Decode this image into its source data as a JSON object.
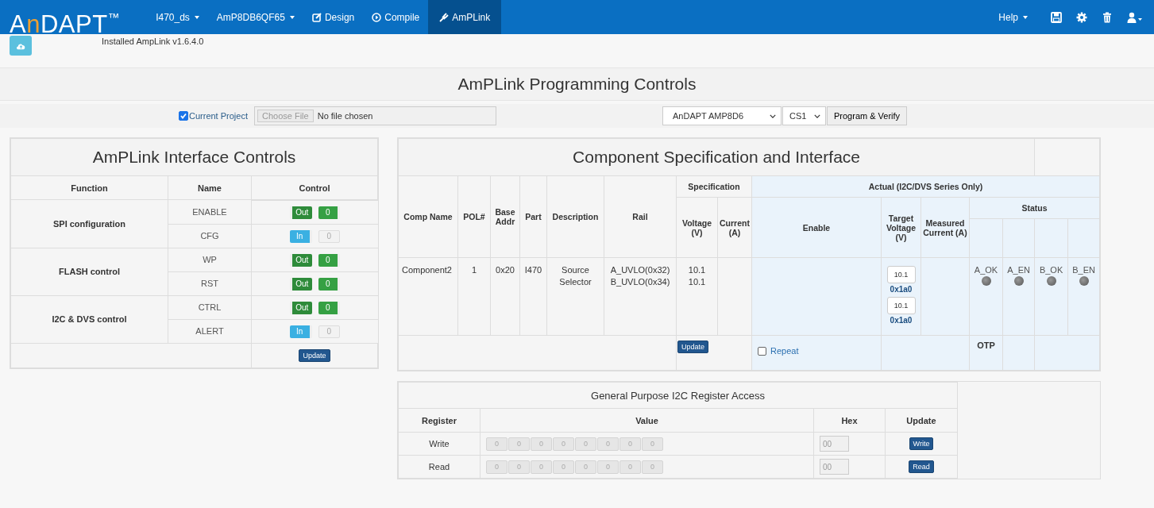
{
  "navbar": {
    "logo": {
      "start": "A",
      "accent": "n",
      "end": "DAPT",
      "mark": "™"
    },
    "items": [
      {
        "label": "I470_ds",
        "kind": "dropdown",
        "selected": false
      },
      {
        "label": "AmP8DB6QF65",
        "kind": "dropdown",
        "selected": false
      },
      {
        "label": "Design",
        "kind": "link",
        "selected": false
      },
      {
        "label": "Compile",
        "kind": "link",
        "selected": false
      },
      {
        "label": "AmPLink",
        "kind": "link",
        "selected": true
      }
    ],
    "help": "Help"
  },
  "install_note": "Installed AmpLink v1.6.4.0",
  "page_title": "AmPLink Programming Controls",
  "program_bar": {
    "current_project": {
      "label": "Current Project",
      "checked": true
    },
    "file_button": "Choose File",
    "file_status": "No file chosen",
    "device": "AnDAPT AMP8D6",
    "chip_select": "CS1",
    "program_button": "Program & Verify"
  },
  "interface_panel": {
    "title": "AmPLink Interface Controls",
    "columns": [
      "Function",
      "Name",
      "Control"
    ],
    "groups": [
      {
        "function": "SPI configuration",
        "signals": [
          {
            "name": "ENABLE",
            "direction": "Out",
            "output": true,
            "value": "0"
          },
          {
            "name": "CFG",
            "direction": "In",
            "output": false,
            "value": "0"
          }
        ]
      },
      {
        "function": "FLASH control",
        "signals": [
          {
            "name": "WP",
            "direction": "Out",
            "output": true,
            "value": "0"
          },
          {
            "name": "RST",
            "direction": "Out",
            "output": true,
            "value": "0"
          }
        ]
      },
      {
        "function": "I2C & DVS control",
        "signals": [
          {
            "name": "CTRL",
            "direction": "Out",
            "output": true,
            "value": "0"
          },
          {
            "name": "ALERT",
            "direction": "In",
            "output": false,
            "value": "0"
          }
        ]
      }
    ],
    "update_button": "Update"
  },
  "component_panel": {
    "title": "Component Specification and Interface",
    "group_headers": [
      "Specification",
      "Actual (I2C/DVS Series Only)"
    ],
    "columns": [
      "Comp Name",
      "POL#",
      "Base Addr",
      "Part",
      "Description",
      "Rail"
    ],
    "spec_columns": [
      "Voltage (V)",
      "Current (A)"
    ],
    "actual_columns": [
      "Enable",
      "Target Voltage (V)",
      "Measured Current (A)"
    ],
    "status_header": "Status",
    "row": {
      "comp_name": "Component2",
      "pol": "1",
      "base_addr": "0x20",
      "part": "I470",
      "description": "Source Selector",
      "rails": [
        "A_UVLO(0x32)",
        "B_UVLO(0x34)"
      ],
      "voltages": [
        "10.1",
        "10.1"
      ],
      "targets": [
        {
          "value": "10.1",
          "hex": "0x1a0"
        },
        {
          "value": "10.1",
          "hex": "0x1a0"
        }
      ],
      "status": [
        {
          "label": "A_OK",
          "on": false
        },
        {
          "label": "A_EN",
          "on": false
        },
        {
          "label": "B_OK",
          "on": false
        },
        {
          "label": "B_EN",
          "on": false
        }
      ]
    },
    "update_button": "Update",
    "repeat": {
      "label": "Repeat",
      "checked": false
    },
    "otp": "OTP"
  },
  "register_panel": {
    "title": "General Purpose I2C Register Access",
    "columns": [
      "Register",
      "Value",
      "Hex",
      "Update"
    ],
    "rows": [
      {
        "label": "Write",
        "bits": [
          "0",
          "0",
          "0",
          "0",
          "0",
          "0",
          "0",
          "0"
        ],
        "hex": "00",
        "button": "Write"
      },
      {
        "label": "Read",
        "bits": [
          "0",
          "0",
          "0",
          "0",
          "0",
          "0",
          "0",
          "0"
        ],
        "hex": "00",
        "button": "Read"
      }
    ]
  }
}
